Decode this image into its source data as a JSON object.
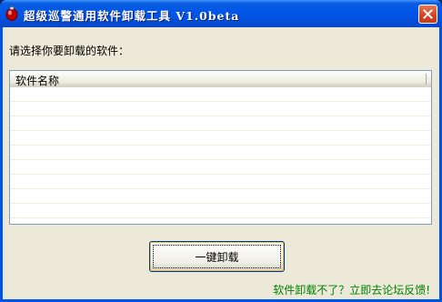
{
  "window": {
    "title": "超级巡警通用软件卸载工具 V1.0beta"
  },
  "icons": {
    "app": "app-icon",
    "close": "close-icon"
  },
  "prompt": "请选择你要卸载的软件：",
  "list": {
    "column_name": "软件名称",
    "rows": []
  },
  "uninstall_button": "一键卸载",
  "feedback_link": "软件卸载不了？立即去论坛反馈!",
  "colors": {
    "titlebar": "#0054e3",
    "close": "#d6411f",
    "link": "#008000",
    "face": "#ece9d8"
  }
}
